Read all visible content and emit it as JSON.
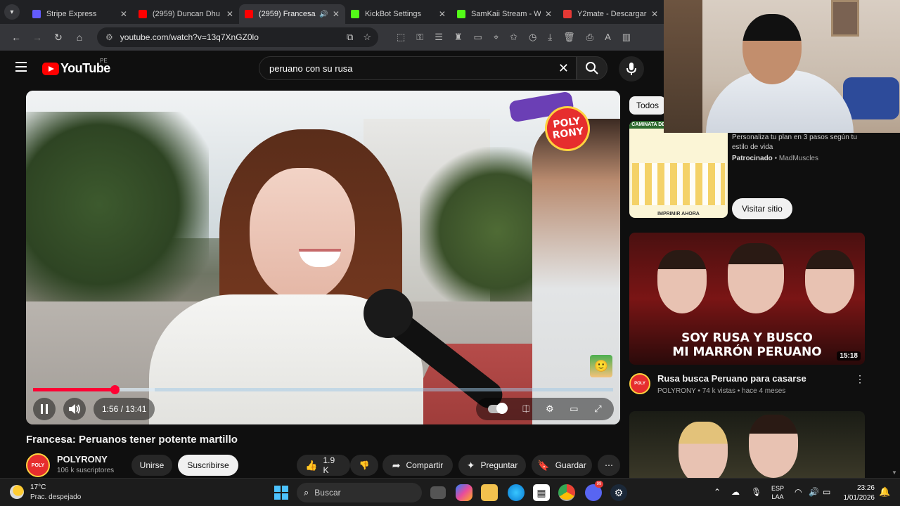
{
  "browser": {
    "tabs": [
      {
        "title": "Stripe Express",
        "favicon_color": "#635bff"
      },
      {
        "title": "(2959) Duncan Dhu",
        "favicon_color": "#ff0000"
      },
      {
        "title": "(2959) Francesa",
        "favicon_color": "#ff0000",
        "active": true
      },
      {
        "title": "KickBot Settings",
        "favicon_color": "#53fc18"
      },
      {
        "title": "SamKaii Stream - Wa",
        "favicon_color": "#53fc18"
      },
      {
        "title": "Y2mate - Descargar",
        "favicon_color": "#e53935"
      }
    ],
    "url": "youtube.com/watch?v=13q7XnGZ0lo"
  },
  "youtube": {
    "logo_text": "YouTube",
    "country_code": "PE",
    "search_query": "peruano con su rusa"
  },
  "player": {
    "current_time": "1:56",
    "duration": "13:41",
    "time_display": "1:56 / 13:41",
    "progress_fraction": 0.141,
    "buffered_fraction": 0.21,
    "badge_line1": "POLY",
    "badge_line2": "RONY"
  },
  "video": {
    "title": "Francesa: Peruanos tener potente martillo",
    "channel_name": "POLYRONY",
    "subscribers": "106 k suscriptores",
    "join_label": "Unirse",
    "subscribe_label": "Suscribirse",
    "likes": "1.9 K",
    "share_label": "Compartir",
    "ask_label": "Preguntar",
    "save_label": "Guardar"
  },
  "sidebar": {
    "chip_all": "Todos",
    "ad": {
      "image_header": "CAMINATA DE TAI CHI SEGÚN EL PESO",
      "image_footer": "IMPRIMIR AHORA",
      "text": "Personaliza tu plan en 3 pasos según tu estilo de vida",
      "sponsored_label": "Patrocinado",
      "advertiser": "MadMuscles",
      "cta": "Visitar sitio"
    },
    "recommendations": [
      {
        "thumb_caption_line1": "SOY RUSA Y BUSCO",
        "thumb_caption_line2": "MI MARRÓN PERUANO",
        "duration": "15:18",
        "title": "Rusa busca Peruano para casarse",
        "meta": "POLYRONY • 74 k vistas • hace 4 meses"
      }
    ]
  },
  "taskbar": {
    "temperature": "17°C",
    "weather": "Prac. despejado",
    "search_placeholder": "Buscar",
    "lang_line1": "ESP",
    "lang_line2": "LAA",
    "time": "23:26",
    "date": "1/01/2026",
    "notification_badge": "99"
  },
  "colors": {
    "accent_red": "#ff0033",
    "youtube_red": "#ff0000",
    "background": "#0f0f0f"
  }
}
